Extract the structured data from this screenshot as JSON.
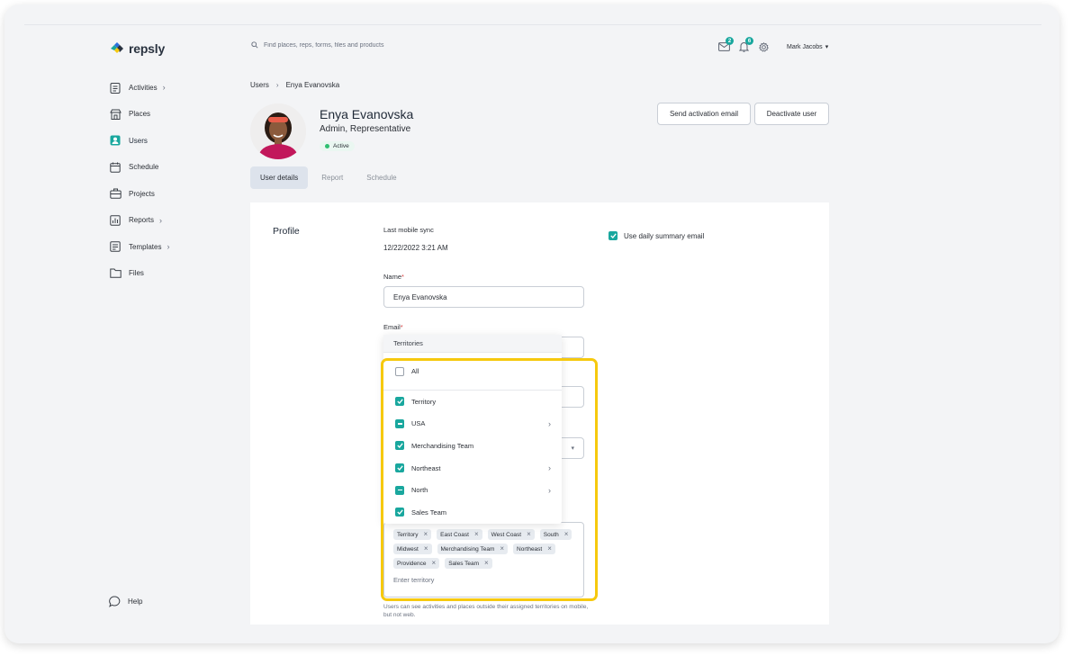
{
  "brand": {
    "name": "repsly"
  },
  "search": {
    "placeholder": "Find places, reps, forms, files and products"
  },
  "header": {
    "mail_count": "2",
    "notif_count": "6",
    "user_name": "Mark Jacobs"
  },
  "sidebar": {
    "items": [
      {
        "label": "Activities",
        "icon": "clipboard-icon",
        "has_chevron": true
      },
      {
        "label": "Places",
        "icon": "store-icon",
        "has_chevron": false
      },
      {
        "label": "Users",
        "icon": "user-icon",
        "has_chevron": false,
        "active": true
      },
      {
        "label": "Schedule",
        "icon": "calendar-icon",
        "has_chevron": false
      },
      {
        "label": "Projects",
        "icon": "briefcase-icon",
        "has_chevron": false
      },
      {
        "label": "Reports",
        "icon": "chart-icon",
        "has_chevron": true
      },
      {
        "label": "Templates",
        "icon": "template-icon",
        "has_chevron": true
      },
      {
        "label": "Files",
        "icon": "folder-icon",
        "has_chevron": false
      }
    ],
    "help_label": "Help"
  },
  "breadcrumb": {
    "root": "Users",
    "current": "Enya Evanovska"
  },
  "user": {
    "name": "Enya Evanovska",
    "role": "Admin, Representative",
    "status": "Active"
  },
  "actions": {
    "send_activation": "Send activation email",
    "deactivate": "Deactivate user"
  },
  "tabs": [
    "User details",
    "Report",
    "Schedule"
  ],
  "profile": {
    "section_title": "Profile",
    "last_sync_label": "Last mobile sync",
    "last_sync_value": "12/22/2022 3:21 AM",
    "name_label": "Name",
    "name_value": "Enya Evanovska",
    "email_label": "Email",
    "daily_summary_label": "Use daily summary email",
    "territory_help": "Users can see activities and places outside their assigned territories on mobile, but not web.",
    "territory_placeholder": "Enter territory",
    "territory_chips": [
      "Territory",
      "East Coast",
      "West Coast",
      "South",
      "Midwest",
      "Merchandising Team",
      "Northeast",
      "Providence",
      "Sales Team"
    ]
  },
  "territories_dropdown": {
    "header": "Territories",
    "all_label": "All",
    "items": [
      {
        "label": "Territory",
        "state": "checked",
        "has_children": false
      },
      {
        "label": "USA",
        "state": "partial",
        "has_children": true
      },
      {
        "label": "Merchandising Team",
        "state": "checked",
        "has_children": false
      },
      {
        "label": "Northeast",
        "state": "checked",
        "has_children": true
      },
      {
        "label": "North",
        "state": "partial",
        "has_children": true
      },
      {
        "label": "Sales Team",
        "state": "checked",
        "has_children": false
      }
    ]
  },
  "colors": {
    "accent": "#19a79e",
    "highlight": "#f6c90e",
    "required": "#d64545"
  }
}
